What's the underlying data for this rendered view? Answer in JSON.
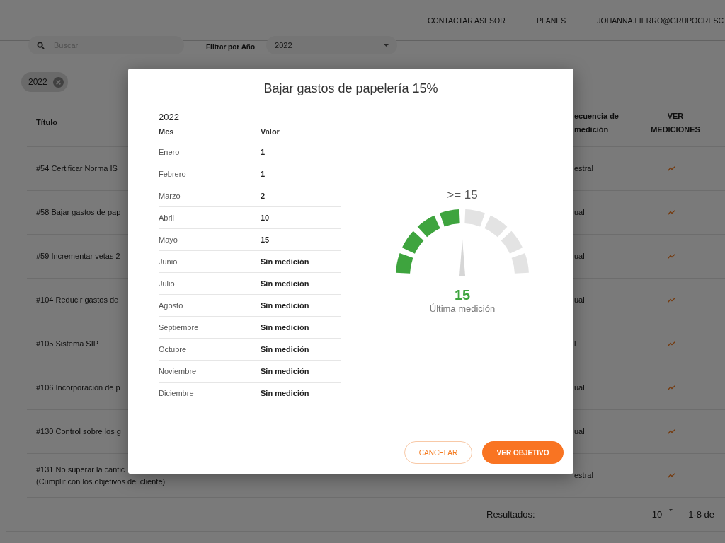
{
  "header": {
    "nav": [
      "CONTACTAR ASESOR",
      "PLANES",
      "JOHANNA.FIERRO@GRUPOCRESC"
    ]
  },
  "filters": {
    "search": {
      "placeholder": "Buscar"
    },
    "year_label": "Filtrar por Año",
    "year_select": {
      "value": "2022"
    }
  },
  "chips": [
    {
      "label": "2022"
    }
  ],
  "table": {
    "columns": [
      "Título",
      "ecuencia de medición",
      "VER MEDICIONES"
    ],
    "rows": [
      {
        "title": "#54 Certificar Norma IS",
        "column_2": "estral"
      },
      {
        "title": "#58 Bajar gastos de pap",
        "column_2": "ual"
      },
      {
        "title": "#59 Incrementar vetas 2",
        "column_2": "ual"
      },
      {
        "title": "#104 Reducir gastos de",
        "column_2": "ual"
      },
      {
        "title": "#105 Sistema SIP",
        "column_2": "l"
      },
      {
        "title": "#106 Incorporación de p",
        "column_2": "ual"
      },
      {
        "title": "#130 Control sobre los g",
        "column_2": "ual"
      },
      {
        "title": "#131 No superar la cantic\n(Cumplir con los objetivos del cliente)",
        "column_2": "estral"
      }
    ]
  },
  "pagination": {
    "label": "Resultados:",
    "per_page": "10",
    "range": "1-8 de"
  },
  "modal": {
    "title": "Bajar gastos de papelería 15%",
    "year": "2022",
    "columns": [
      "Mes",
      "Valor"
    ],
    "rows": [
      {
        "month": "Enero",
        "value": "1"
      },
      {
        "month": "Febrero",
        "value": "1"
      },
      {
        "month": "Marzo",
        "value": "2"
      },
      {
        "month": "Abril",
        "value": "10"
      },
      {
        "month": "Mayo",
        "value": "15"
      },
      {
        "month": "Junio",
        "value": "Sin medición"
      },
      {
        "month": "Julio",
        "value": "Sin medición"
      },
      {
        "month": "Agosto",
        "value": "Sin medición"
      },
      {
        "month": "Septiembre",
        "value": "Sin medición"
      },
      {
        "month": "Octubre",
        "value": "Sin medición"
      },
      {
        "month": "Noviembre",
        "value": "Sin medición"
      },
      {
        "month": "Diciembre",
        "value": "Sin medición"
      }
    ],
    "gauge": {
      "target": ">= 15",
      "level": 0.5,
      "value": "15",
      "caption": "Última medición"
    },
    "buttons": [
      {
        "label": "CANCELAR",
        "kind": "secondary"
      },
      {
        "label": "VER OBJETIVO",
        "kind": "primary"
      }
    ]
  }
}
